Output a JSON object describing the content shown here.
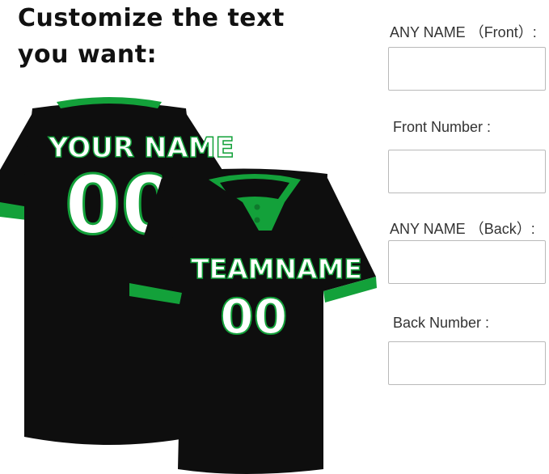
{
  "heading": {
    "line1": "Customize the text",
    "line2": "you want:"
  },
  "form": {
    "fields": [
      {
        "label": "ANY NAME （Front）:",
        "value": ""
      },
      {
        "label": "Front Number :",
        "value": ""
      },
      {
        "label": "ANY NAME （Back）:",
        "value": ""
      },
      {
        "label": "Back Number :",
        "value": ""
      }
    ]
  },
  "jersey_back": {
    "name": "YOUR NAME",
    "number": "00"
  },
  "jersey_front": {
    "name": "TEAMNAME",
    "number": "00"
  },
  "colors": {
    "body": "#0e0e0e",
    "trim": "#13a13a",
    "letter": "#ffffff",
    "outline": "#13a13a"
  }
}
